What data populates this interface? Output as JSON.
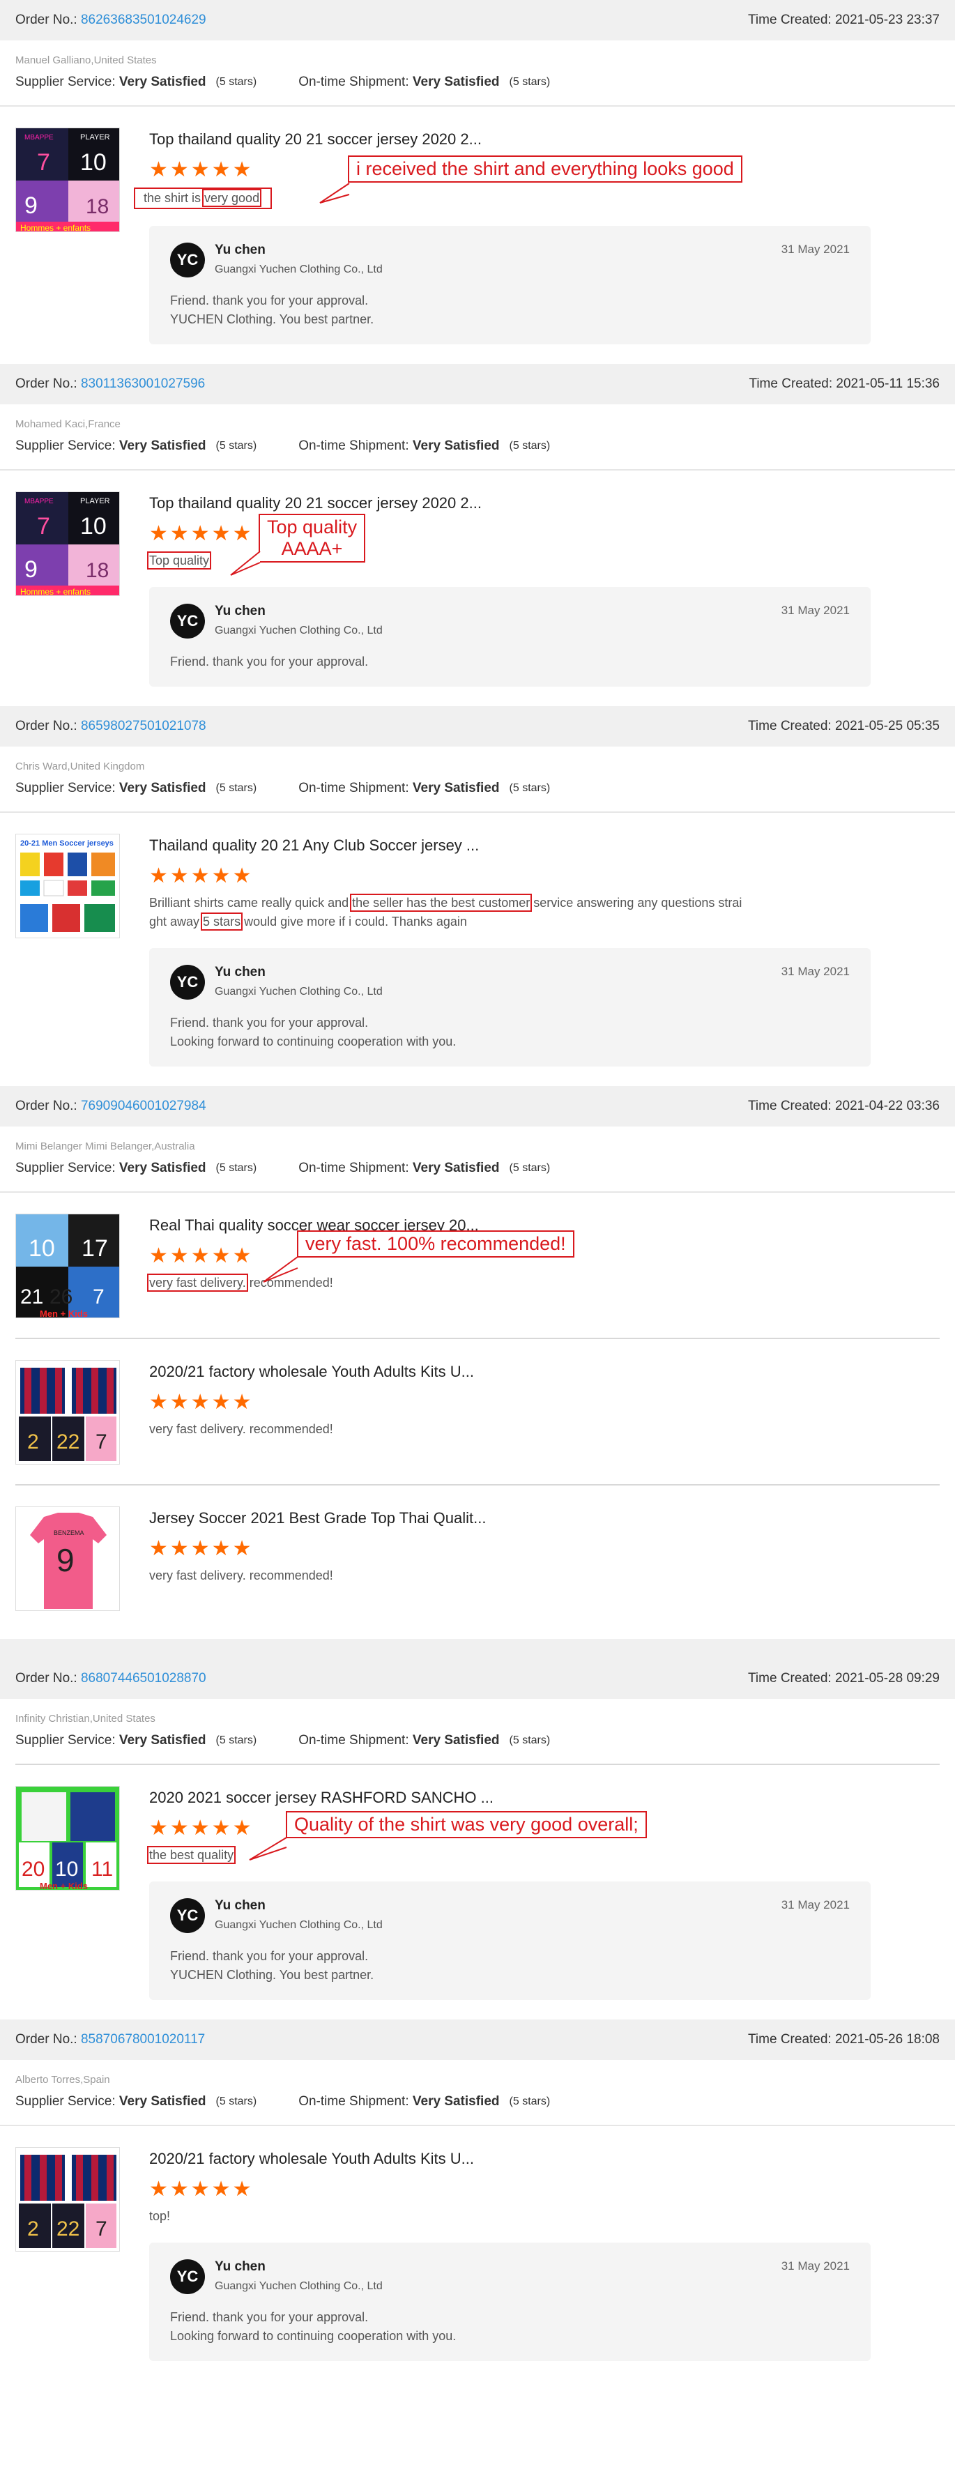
{
  "common": {
    "order_no_label": "Order No.:",
    "time_label": "Time Created:",
    "supplier_label": "Supplier Service:",
    "shipment_label": "On-time Shipment:",
    "satisfied": "Very Satisfied",
    "five_stars": "(5 stars)",
    "stars": "★★★★★",
    "reply_name": "Yu chen",
    "reply_company": "Guangxi Yuchen Clothing Co., Ltd",
    "reply_date": "31 May 2021",
    "logo_text": "YC"
  },
  "orders": [
    {
      "order_no": "86263683501024629",
      "time": "2021-05-23 23:37",
      "buyer": "Manuel Galliano,United States",
      "products": [
        {
          "title": "Top thailand quality 20 21 soccer jersey 2020 2...",
          "comment_pre": "the shirt is ",
          "comment_mark": "very good",
          "comment_post": "",
          "callout": "i received the shirt and everything looks good",
          "reply_lines": [
            "Friend. thank you for your approval.",
            "YUCHEN Clothing. You best partner."
          ]
        }
      ]
    },
    {
      "order_no": "83011363001027596",
      "time": "2021-05-11 15:36",
      "buyer": "Mohamed Kaci,France",
      "products": [
        {
          "title": "Top thailand quality 20 21 soccer jersey 2020 2...",
          "comment_mark": "Top quality",
          "callout_l1": "Top quality",
          "callout_l2": "AAAA+",
          "reply_lines": [
            "Friend. thank you for your approval."
          ]
        }
      ]
    },
    {
      "order_no": "86598027501021078",
      "time": "2021-05-25 05:35",
      "buyer": "Chris Ward,United Kingdom",
      "products": [
        {
          "title": "Thailand quality 20 21 Any Club Soccer jersey ...",
          "c1": "Brilliant shirts came really quick and ",
          "c2": "the seller has the best customer",
          "c3": " service answering any questions strai",
          "c4": "ght away ",
          "c5": "5 stars",
          "c6": " would give more if i could. Thanks again",
          "reply_lines": [
            "Friend. thank you for your approval.",
            "Looking forward to continuing cooperation with you."
          ]
        }
      ]
    },
    {
      "order_no": "76909046001027984",
      "time": "2021-04-22 03:36",
      "buyer": "Mimi Belanger Mimi Belanger,Australia",
      "products": [
        {
          "title": "Real Thai quality soccer wear soccer jersey 20...",
          "comment_mark": "very fast delivery.",
          "comment_post": " recommended!",
          "callout": "very fast. 100% recommended!"
        },
        {
          "title": "2020/21 factory wholesale Youth Adults Kits U...",
          "comment": "very fast delivery. recommended!"
        },
        {
          "title": "Jersey Soccer 2021 Best Grade Top Thai Qualit...",
          "comment": "very fast delivery. recommended!"
        }
      ]
    },
    {
      "order_no": "86807446501028870",
      "time": "2021-05-28 09:29",
      "buyer": "Infinity Christian,United States",
      "products": [
        {
          "title": "2020 2021 soccer jersey RASHFORD SANCHO ...",
          "comment_mark": "the best quality",
          "callout": "Quality of the shirt was very good overall;",
          "reply_lines": [
            "Friend. thank you for your approval.",
            "YUCHEN Clothing. You best partner."
          ]
        }
      ]
    },
    {
      "order_no": "85870678001020117",
      "time": "2021-05-26 18:08",
      "buyer": "Alberto Torres,Spain",
      "products": [
        {
          "title": "2020/21 factory wholesale Youth Adults Kits U...",
          "comment": "top!",
          "reply_lines": [
            "Friend. thank you for your approval.",
            "Looking forward to continuing cooperation with you."
          ]
        }
      ]
    }
  ],
  "thumb_texts": {
    "t1_a": "MBAPPE",
    "t1_b": "PLAYER",
    "t1_c": "10",
    "t1_d": "7",
    "t1_e": "9",
    "t1_f": "18",
    "t1_g": "Hommes + enfants",
    "t3_a": "20-21 Men Soccer jerseys",
    "t4_a": "10",
    "t4_b": "17",
    "t4_c": "21",
    "t4_d": "26",
    "t4_e": "7",
    "t4_f": "Men + Kids",
    "t5_a": "2",
    "t5_b": "22",
    "t5_c": "7",
    "t6_a": "BENZEMA",
    "t6_b": "9",
    "t7_a": "20",
    "t7_b": "10",
    "t7_c": "11",
    "t7_d": "Men + Kids"
  },
  "colors": {
    "accent": "#ff6a00",
    "link": "#2f8fd8",
    "annotation": "#d9191e"
  }
}
